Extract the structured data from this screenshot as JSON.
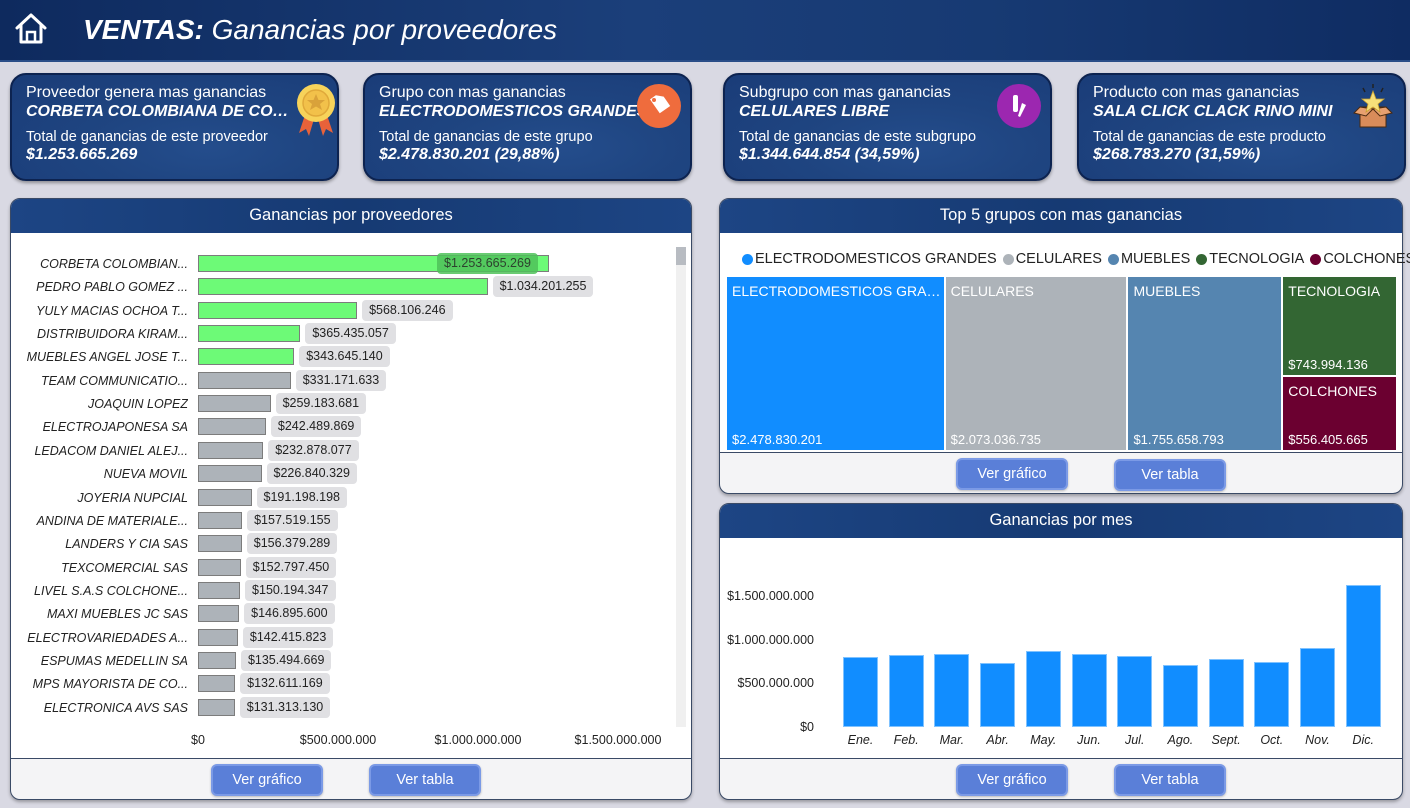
{
  "header": {
    "title_bold": "VENTAS:",
    "title_rest": " Ganancias por proveedores",
    "home_icon": "home-icon"
  },
  "kpis": [
    {
      "label": "Proveedor genera mas ganancias",
      "value": "CORBETA COLOMBIANA DE COM...",
      "sub": "Total de ganancias de este proveedor",
      "total": "$1.253.665.269",
      "icon": "award-medal-icon"
    },
    {
      "label": "Grupo con mas ganancias",
      "value": "ELECTRODOMESTICOS GRANDES",
      "sub": "Total de ganancias de este grupo",
      "total": "$2.478.830.201 (29,88%)",
      "icon": "price-tag-icon"
    },
    {
      "label": "Subgrupo con mas ganancias",
      "value": "CELULARES LIBRE",
      "sub": "Total de ganancias de este subgrupo",
      "total": "$1.344.644.854 (34,59%)",
      "icon": "phone-pen-icon"
    },
    {
      "label": "Producto con mas ganancias",
      "value": "SALA CLICK CLACK RINO MINI",
      "sub": "Total de ganancias de este producto",
      "total": "$268.783.270 (31,59%)",
      "icon": "star-box-icon"
    }
  ],
  "buttons": {
    "chart": "Ver gráfico",
    "table": "Ver tabla"
  },
  "colors": {
    "highlight_bar": "#6dfa77",
    "default_bar": "#adb3b9",
    "month_bar": "#118dff"
  },
  "chart_data": [
    {
      "type": "bar",
      "orientation": "horizontal",
      "title": "Ganancias por proveedores",
      "xlim": [
        0,
        1500000000
      ],
      "x_ticks": [
        "$0",
        "$500.000.000",
        "$1.000.000.000",
        "$1.500.000.000"
      ],
      "highlight_top_n": 5,
      "categories": [
        "CORBETA COLOMBIAN...",
        "PEDRO PABLO GOMEZ ...",
        "YULY MACIAS OCHOA T...",
        "DISTRIBUIDORA KIRAM...",
        "MUEBLES ANGEL JOSE T...",
        "TEAM COMMUNICATIO...",
        "JOAQUIN LOPEZ",
        "ELECTROJAPONESA SA",
        "LEDACOM DANIEL ALEJ...",
        "NUEVA MOVIL",
        "JOYERIA NUPCIAL",
        "ANDINA DE MATERIALE...",
        "LANDERS Y CIA SAS",
        "TEXCOMERCIAL SAS",
        "LIVEL S.A.S COLCHONE...",
        "MAXI MUEBLES JC SAS",
        "ELECTROVARIEDADES A...",
        "ESPUMAS MEDELLIN SA",
        "MPS MAYORISTA DE CO...",
        "ELECTRONICA AVS SAS"
      ],
      "values": [
        1253665269,
        1034201255,
        568106246,
        365435057,
        343645140,
        331171633,
        259183681,
        242489869,
        232878077,
        226840329,
        191198198,
        157519155,
        156379289,
        152797450,
        150194347,
        146895600,
        142415823,
        135494669,
        132611169,
        131313130
      ],
      "labels": [
        "$1.253.665.269",
        "$1.034.201.255",
        "$568.106.246",
        "$365.435.057",
        "$343.645.140",
        "$331.171.633",
        "$259.183.681",
        "$242.489.869",
        "$232.878.077",
        "$226.840.329",
        "$191.198.198",
        "$157.519.155",
        "$156.379.289",
        "$152.797.450",
        "$150.194.347",
        "$146.895.600",
        "$142.415.823",
        "$135.494.669",
        "$132.611.169",
        "$131.313.130"
      ]
    },
    {
      "type": "treemap",
      "title": "Top 5 grupos con mas ganancias",
      "legend_position": "top",
      "categories": [
        "ELECTRODOMESTICOS GRANDES",
        "CELULARES",
        "MUEBLES",
        "TECNOLOGIA",
        "COLCHONES"
      ],
      "display_names": [
        "ELECTRODOMESTICOS GRAN...",
        "CELULARES",
        "MUEBLES",
        "TECNOLOGIA",
        "COLCHONES"
      ],
      "values": [
        2478830201,
        2073036735,
        1755658793,
        743994136,
        556405665
      ],
      "labels": [
        "$2.478.830.201",
        "$2.073.036.735",
        "$1.755.658.793",
        "$743.994.136",
        "$556.405.665"
      ],
      "colors": [
        "#118dff",
        "#adb3b9",
        "#5585b0",
        "#336633",
        "#6b0030"
      ]
    },
    {
      "type": "bar",
      "title": "Ganancias por mes",
      "categories": [
        "Ene.",
        "Feb.",
        "Mar.",
        "Abr.",
        "May.",
        "Jun.",
        "Jul.",
        "Ago.",
        "Sept.",
        "Oct.",
        "Nov.",
        "Dic."
      ],
      "values": [
        800000000,
        820000000,
        840000000,
        730000000,
        870000000,
        840000000,
        810000000,
        710000000,
        780000000,
        740000000,
        900000000,
        1630000000
      ],
      "ylim": [
        0,
        1500000000
      ],
      "y_ticks": [
        {
          "value": 0,
          "label": "$0"
        },
        {
          "value": 500000000,
          "label": "$500.000.000"
        },
        {
          "value": 1000000000,
          "label": "$1.000.000.000"
        },
        {
          "value": 1500000000,
          "label": "$1.500.000.000"
        }
      ],
      "xlabel": "",
      "ylabel": ""
    }
  ]
}
